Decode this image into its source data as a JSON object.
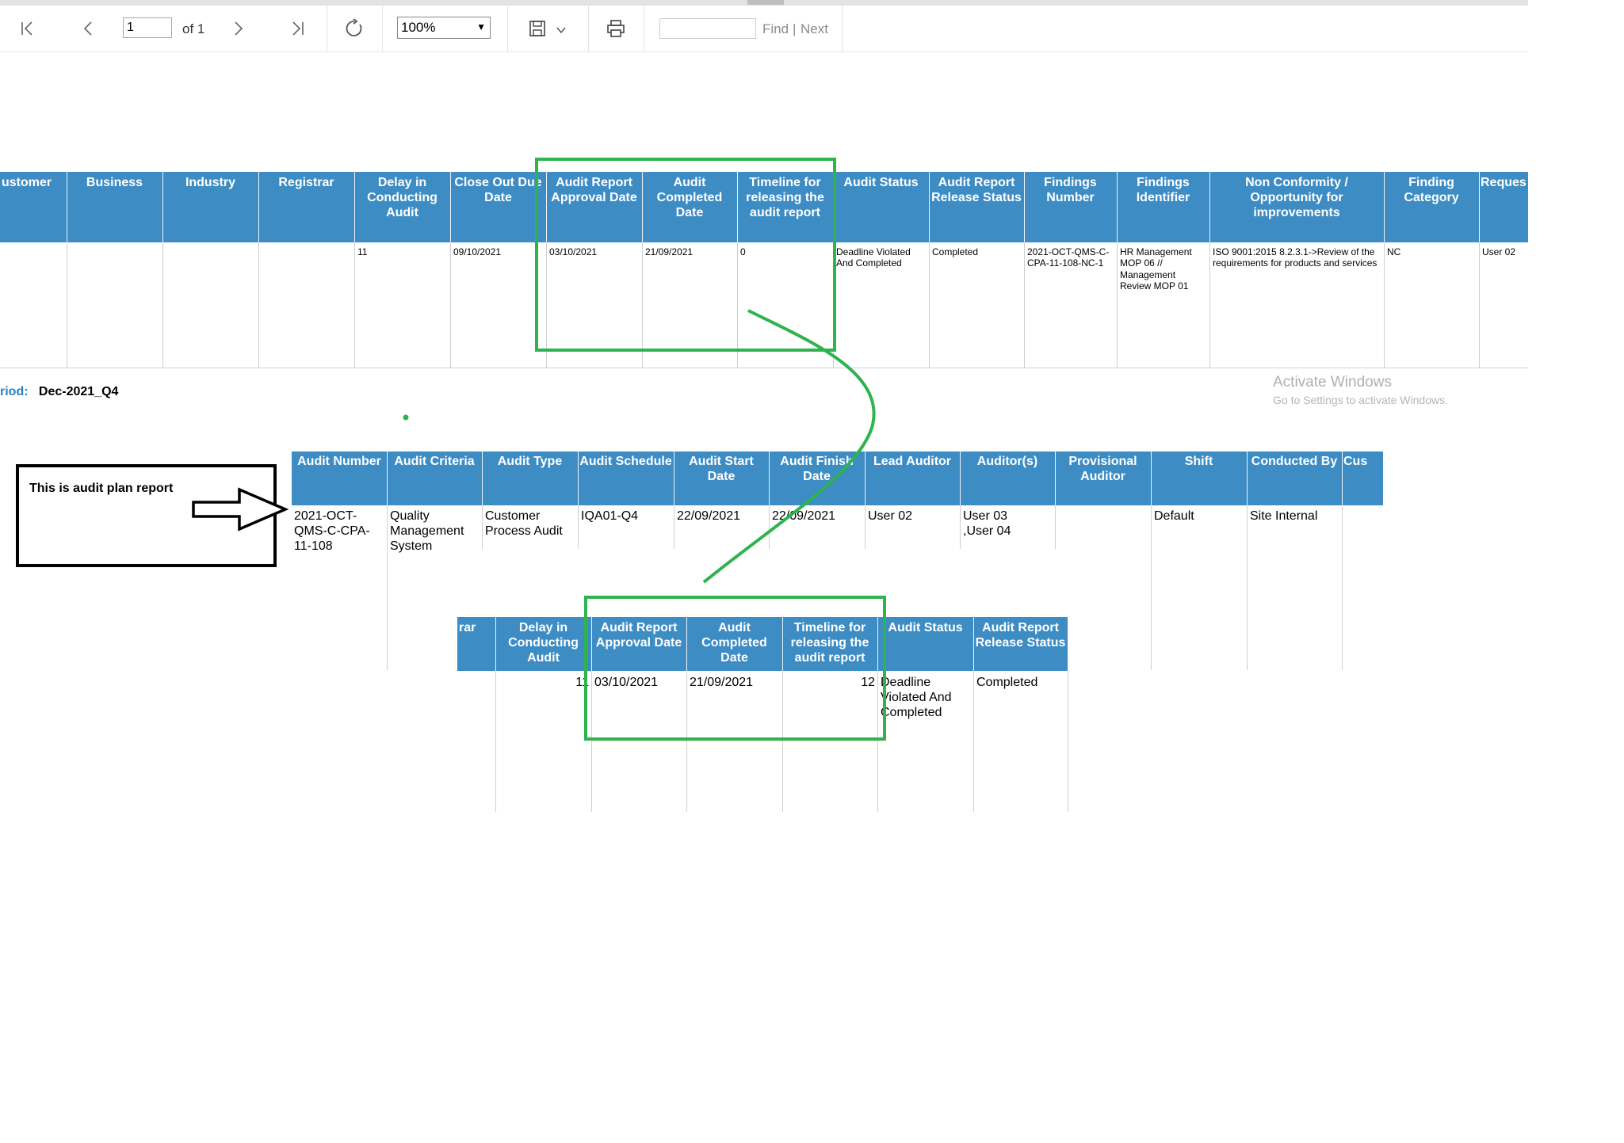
{
  "toolbar": {
    "page_input": "1",
    "page_of": "of 1",
    "zoom": "100%",
    "find_label": "Find",
    "find_sep": "|",
    "next_label": "Next"
  },
  "table1": {
    "headers": {
      "customer": "ustomer",
      "business": "Business",
      "industry": "Industry",
      "registrar": "Registrar",
      "delay": "Delay in Conducting Audit",
      "close_out": "Close Out Due Date",
      "approval": "Audit Report Approval Date",
      "completed": "Audit Completed Date",
      "timeline": "Timeline for releasing the audit report",
      "status": "Audit Status",
      "release": "Audit Report Release Status",
      "findings_number": "Findings Number",
      "findings_identifier": "Findings Identifier",
      "nonconformity": "Non Conformity / Opportunity for improvements",
      "finding_category": "Finding Category",
      "request": "Reques"
    },
    "row": {
      "delay": "11",
      "close_out": "09/10/2021",
      "approval": "03/10/2021",
      "completed": "21/09/2021",
      "timeline": "0",
      "status": "Deadline Violated And Completed",
      "release": "Completed",
      "findings_number": "2021-OCT-QMS-C-CPA-11-108-NC-1",
      "findings_identifier": "HR Management MOP 06 // Management Review MOP 01",
      "nonconformity": "ISO 9001:2015 8.2.3.1->Review of the requirements for products and services",
      "finding_category": "NC",
      "request": "User 02"
    }
  },
  "period": {
    "label": "riod:",
    "value": "Dec-2021_Q4"
  },
  "watermark": {
    "title": "Activate Windows",
    "subtitle": "Go to Settings to activate Windows."
  },
  "annotation": {
    "text": "This is audit plan report"
  },
  "table2": {
    "headers": {
      "audit_number": "Audit Number",
      "audit_criteria": "Audit Criteria",
      "audit_type": "Audit Type",
      "audit_schedule": "Audit Schedule",
      "start_date": "Audit Start Date",
      "finish_date": "Audit Finish Date",
      "lead_auditor": "Lead Auditor",
      "auditors": "Auditor(s)",
      "provisional": "Provisional Auditor",
      "shift": "Shift",
      "conducted_by": "Conducted By",
      "cus": "Cus"
    },
    "row": {
      "audit_number": "2021-OCT-QMS-C-CPA-11-108",
      "audit_criteria": "Quality Management System",
      "audit_type": "Customer Process Audit",
      "audit_schedule": "IQA01-Q4",
      "start_date": "22/09/2021",
      "finish_date": "22/09/2021",
      "lead_auditor": "User 02",
      "auditors": "User 03 ,User 04",
      "provisional": "",
      "shift": "Default",
      "conducted_by": "Site Internal"
    }
  },
  "table3": {
    "headers": {
      "registrar": "rar",
      "delay": "Delay in Conducting Audit",
      "approval": "Audit Report Approval Date",
      "completed": "Audit Completed Date",
      "timeline": "Timeline for releasing the audit report",
      "status": "Audit Status",
      "release": "Audit Report Release Status"
    },
    "row": {
      "delay": "11",
      "approval": "03/10/2021",
      "completed": "21/09/2021",
      "timeline": "12",
      "status": "Deadline Violated And Completed",
      "release": "Completed"
    }
  },
  "colors": {
    "header_blue": "#3d8cc4",
    "highlight_green": "#2eb34f",
    "link_blue": "#2d7fbf"
  }
}
